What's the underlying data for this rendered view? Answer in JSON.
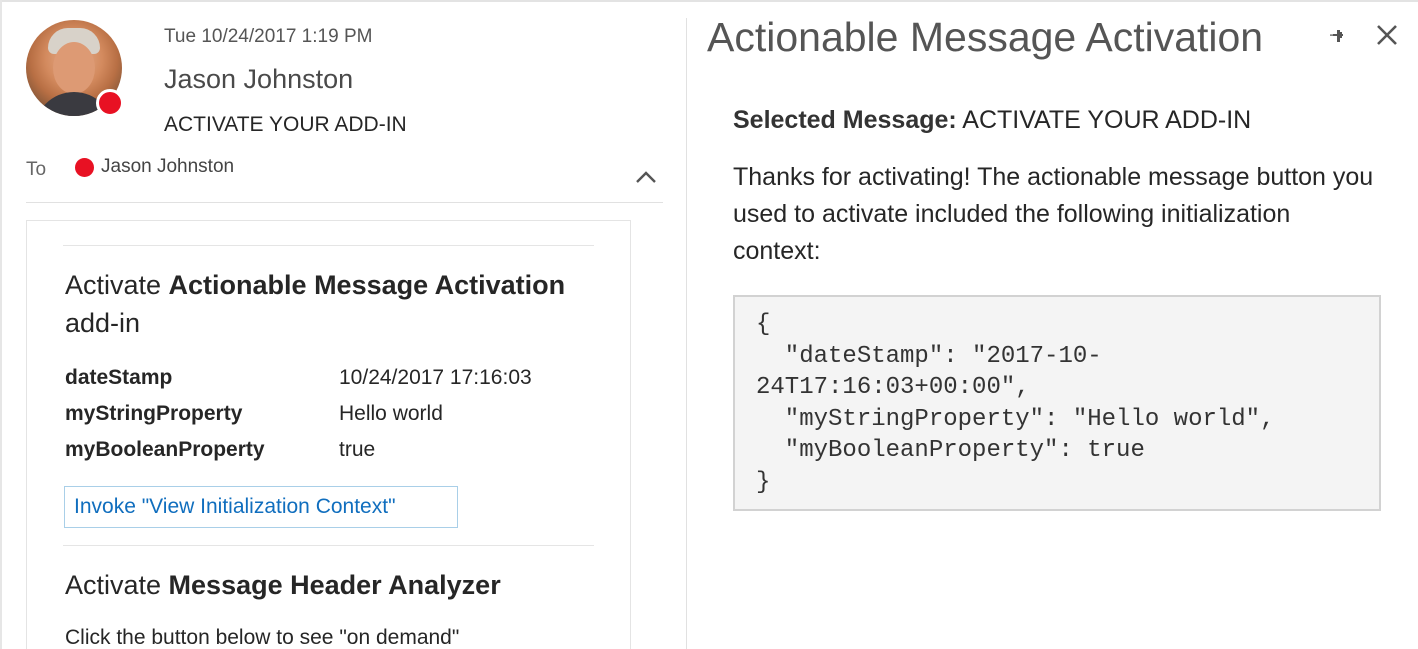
{
  "message": {
    "date": "Tue 10/24/2017 1:19 PM",
    "sender": "Jason Johnston",
    "subject": "ACTIVATE YOUR ADD-IN",
    "to_label": "To",
    "to_name": "Jason Johnston",
    "presence_color": "#e81123"
  },
  "card": {
    "section1": {
      "title_prefix": "Activate ",
      "title_bold": "Actionable Message Activation",
      "title_suffix": " add-in",
      "facts": [
        {
          "name": "dateStamp",
          "value": "10/24/2017 17:16:03"
        },
        {
          "name": "myStringProperty",
          "value": "Hello world"
        },
        {
          "name": "myBooleanProperty",
          "value": "true"
        }
      ],
      "action_label": "Invoke \"View Initialization Context\""
    },
    "section2": {
      "title_prefix": "Activate ",
      "title_bold": "Message Header Analyzer",
      "body": "Click the button below to see \"on demand\""
    }
  },
  "pane": {
    "title": "Actionable Message Activation",
    "selected_label": "Selected Message:",
    "selected_value": "ACTIVATE YOUR ADD-IN",
    "description": "Thanks for activating! The actionable message button you used to activate included the following initialization context:",
    "code_lines": [
      "{",
      "  \"dateStamp\": \"2017-10-",
      "24T17:16:03+00:00\",",
      "  \"myStringProperty\": \"Hello world\",",
      "  \"myBooleanProperty\": true",
      "}"
    ]
  },
  "colors": {
    "accent_link": "#106ebe",
    "presence_busy": "#e81123",
    "code_background": "#f4f4f4"
  },
  "icons": [
    "avatar",
    "presence-busy-icon",
    "chevron-up-icon",
    "pin-icon",
    "close-icon"
  ]
}
